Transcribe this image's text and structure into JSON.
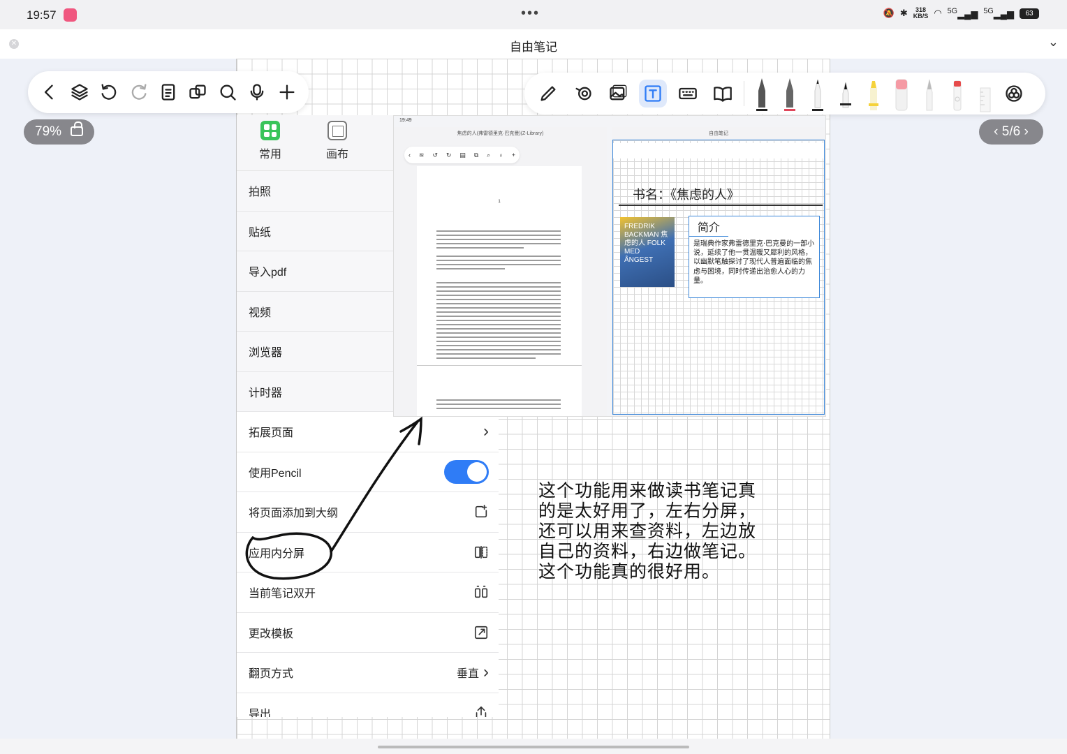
{
  "status_bar": {
    "time": "19:57",
    "dots": "•••",
    "net_speed": "318",
    "net_unit": "KB/S",
    "signal1": "5G",
    "signal2": "5G",
    "battery": "63"
  },
  "title_bar": {
    "title": "自由笔记"
  },
  "zoom": {
    "label": "79%"
  },
  "pager": {
    "label": "5/6",
    "prev": "‹",
    "next": "›"
  },
  "panel": {
    "tabs": [
      {
        "label": "常用"
      },
      {
        "label": "画布"
      }
    ],
    "items": [
      {
        "label": "拍照"
      },
      {
        "label": "贴纸"
      },
      {
        "label": "导入pdf"
      },
      {
        "label": "视频"
      },
      {
        "label": "浏览器"
      },
      {
        "label": "计时器"
      },
      {
        "label": "拓展页面",
        "chevron": "›"
      },
      {
        "label": "使用Pencil",
        "toggle_on": true
      },
      {
        "label": "将页面添加到大纲"
      },
      {
        "label": "应用内分屏"
      },
      {
        "label": "当前笔记双开"
      },
      {
        "label": "更改模板"
      },
      {
        "label": "翻页方式",
        "value": "垂直",
        "chevron": "›"
      },
      {
        "label": "导出"
      }
    ]
  },
  "screenshot": {
    "time": "19:49",
    "left_title": "焦虑的人(弗雷德里克·巴克曼)(Z-Library)",
    "page_num": "1",
    "right_title": "自由笔记",
    "book_label": "书名：《焦虑的人》",
    "cover_text": "FREDRIK BACKMAN 焦虑的人 FOLK MED ÅNGEST",
    "intro_heading": "简介",
    "intro_text": "是瑞典作家弗雷德里克·巴克曼的一部小说，延续了他一贯温暖又犀利的风格，以幽默笔触探讨了现代人普遍面临的焦虑与困境，同时传递出治愈人心的力量。"
  },
  "handwritten_note": "这个功能用来做读书笔记真的是太好用了，左右分屏，还可以用来查资料，左边放自己的资料，右边做笔记。这个功能真的很好用。",
  "colors": {
    "accent": "#2f7cf6",
    "pill_bg": "#87878c",
    "app_icon": "#f0577f",
    "green_icon": "#39c45a"
  }
}
